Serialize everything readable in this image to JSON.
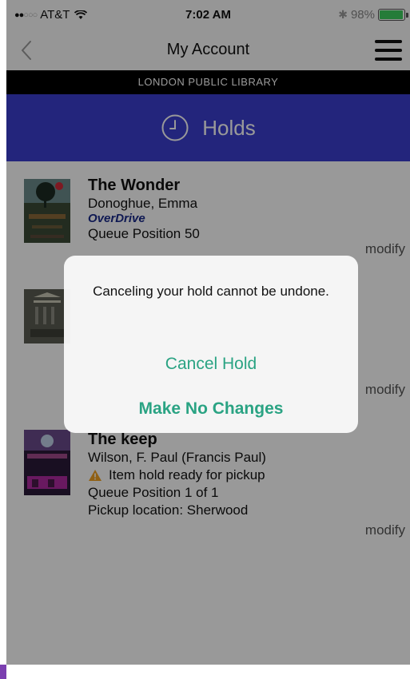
{
  "status_bar": {
    "carrier": "AT&T",
    "time": "7:02 AM",
    "battery": "98%",
    "signal_bars": "●●○○○"
  },
  "nav": {
    "title": "My Account",
    "back_icon": "chevron-left-icon",
    "menu_icon": "hamburger-menu-icon"
  },
  "library_name": "LONDON PUBLIC LIBRARY",
  "section": {
    "title": "Holds",
    "icon": "clock-icon"
  },
  "holds": [
    {
      "title": "The Wonder",
      "author": "Donoghue, Emma",
      "source": "OverDrive",
      "queue": "Queue Position 50",
      "action": "modify"
    },
    {
      "action": "modify"
    },
    {
      "title": "The keep",
      "author": "Wilson, F. Paul (Francis Paul)",
      "status": "Item hold ready for pickup",
      "queue": "Queue Position 1 of 1",
      "pickup": "Pickup location: Sherwood",
      "action": "modify"
    }
  ],
  "alert": {
    "message": "Canceling your hold cannot be undone.",
    "primary": "Cancel Hold",
    "secondary": "Make No Changes"
  },
  "colors": {
    "accent": "#2aa383",
    "holds_header": "#3b3fcf",
    "banner": "#000000",
    "warning": "#f0a020"
  }
}
